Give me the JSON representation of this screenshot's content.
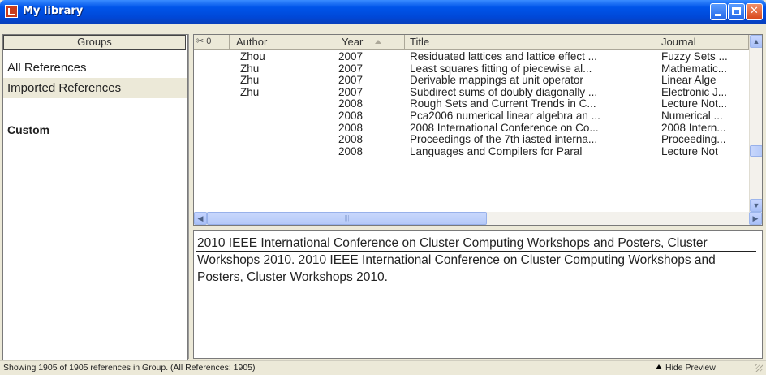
{
  "window": {
    "title": "My library"
  },
  "groups": {
    "header": "Groups",
    "items": [
      {
        "label": "All References"
      },
      {
        "label": "Imported References"
      },
      {
        "label": "Custom"
      }
    ]
  },
  "columns": {
    "icons": "✂ 0",
    "author": "Author",
    "year": "Year",
    "title": "Title",
    "journal": "Journal"
  },
  "rows": [
    {
      "author": "Zhou",
      "year": "2007",
      "title": "Residuated lattices and lattice effect ...",
      "journal": "Fuzzy Sets ..."
    },
    {
      "author": "Zhu",
      "year": "2007",
      "title": "Least squares fitting of piecewise al...",
      "journal": "Mathematic..."
    },
    {
      "author": "Zhu",
      "year": "2007",
      "title": "Derivable mappings at unit operator",
      "journal": "Linear Alge"
    },
    {
      "author": "Zhu",
      "year": "2007",
      "title": "Subdirect sums of doubly diagonally ...",
      "journal": "Electronic J..."
    },
    {
      "author": "",
      "year": "2008",
      "title": "Rough Sets and Current Trends in C...",
      "journal": "Lecture Not..."
    },
    {
      "author": "",
      "year": "2008",
      "title": "Pca2006 numerical linear algebra an ...",
      "journal": "Numerical ..."
    },
    {
      "author": "",
      "year": "2008",
      "title": "2008 International Conference on Co...",
      "journal": "2008 Intern..."
    },
    {
      "author": "",
      "year": "2008",
      "title": "Proceedings of the 7th iasted interna...",
      "journal": "Proceeding..."
    },
    {
      "author": "",
      "year": "2008",
      "title": "Languages and Compilers for Paral",
      "journal": "Lecture Not"
    }
  ],
  "preview": {
    "text": "2010 IEEE International Conference on Cluster Computing Workshops and Posters, Cluster Workshops 2010. 2010 IEEE International Conference on Cluster Computing Workshops and Posters, Cluster Workshops 2010."
  },
  "status": {
    "text": "Showing 1905 of 1905 references in Group. (All References: 1905)",
    "hide_preview": "Hide Preview"
  },
  "icons": {
    "app": "library-icon",
    "minimize": "minimize-icon",
    "maximize": "maximize-icon",
    "close": "close-icon",
    "sort": "sort-ascending-icon"
  }
}
